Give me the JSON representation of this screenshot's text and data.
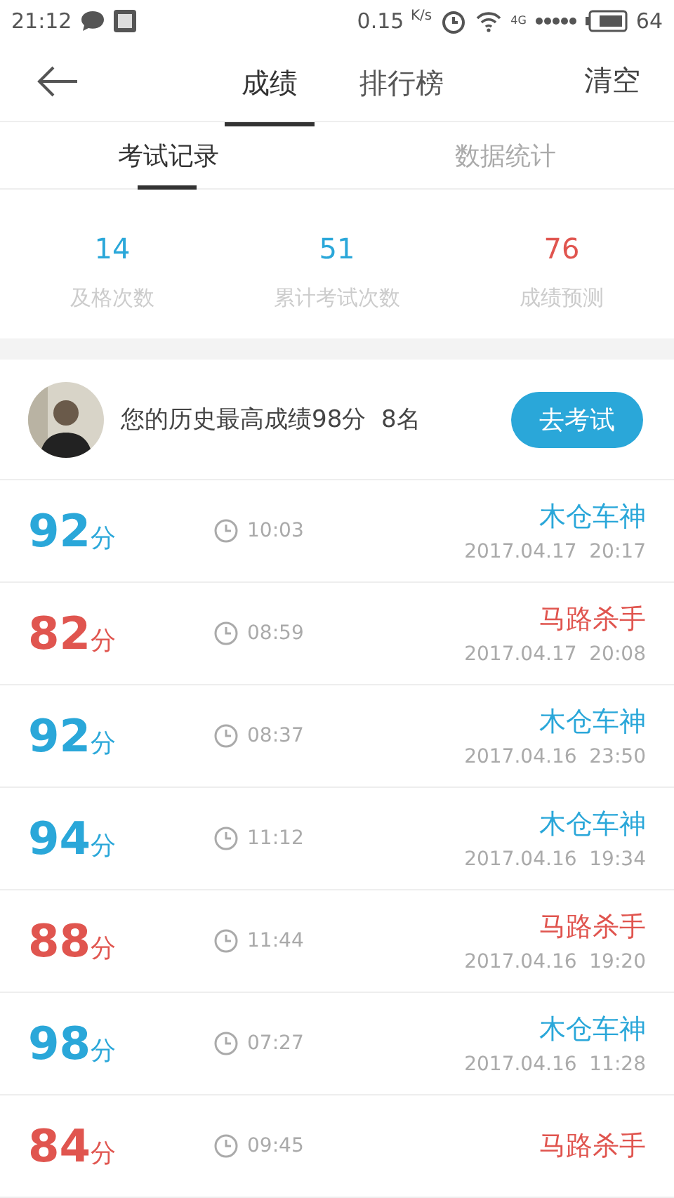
{
  "status_bar": {
    "time": "21:12",
    "speed": "0.15",
    "speed_unit": "K/s",
    "network": "4G",
    "battery": "64"
  },
  "nav": {
    "tabs": [
      {
        "label": "成绩",
        "selected": true
      },
      {
        "label": "排行榜",
        "selected": false
      }
    ],
    "action": "清空"
  },
  "subtabs": [
    {
      "label": "考试记录",
      "selected": true
    },
    {
      "label": "数据统计",
      "selected": false
    }
  ],
  "stats": [
    {
      "value": "14",
      "label": "及格次数",
      "passed": true
    },
    {
      "value": "51",
      "label": "累计考试次数",
      "passed": true
    },
    {
      "value": "76",
      "label": "成绩预测",
      "passed": false
    }
  ],
  "profile": {
    "text": "您的历史最高成绩98分",
    "rank": "8名",
    "button": "去考试"
  },
  "records": [
    {
      "score": "92",
      "unit": "分",
      "duration": "10:03",
      "title": "木仓车神",
      "date": "2017.04.17  20:17",
      "passed": true
    },
    {
      "score": "82",
      "unit": "分",
      "duration": "08:59",
      "title": "马路杀手",
      "date": "2017.04.17  20:08",
      "passed": false
    },
    {
      "score": "92",
      "unit": "分",
      "duration": "08:37",
      "title": "木仓车神",
      "date": "2017.04.16  23:50",
      "passed": true
    },
    {
      "score": "94",
      "unit": "分",
      "duration": "11:12",
      "title": "木仓车神",
      "date": "2017.04.16  19:34",
      "passed": true
    },
    {
      "score": "88",
      "unit": "分",
      "duration": "11:44",
      "title": "马路杀手",
      "date": "2017.04.16  19:20",
      "passed": false
    },
    {
      "score": "98",
      "unit": "分",
      "duration": "07:27",
      "title": "木仓车神",
      "date": "2017.04.16  11:28",
      "passed": true
    },
    {
      "score": "84",
      "unit": "分",
      "duration": "09:45",
      "title": "马路杀手",
      "passed": false
    }
  ]
}
